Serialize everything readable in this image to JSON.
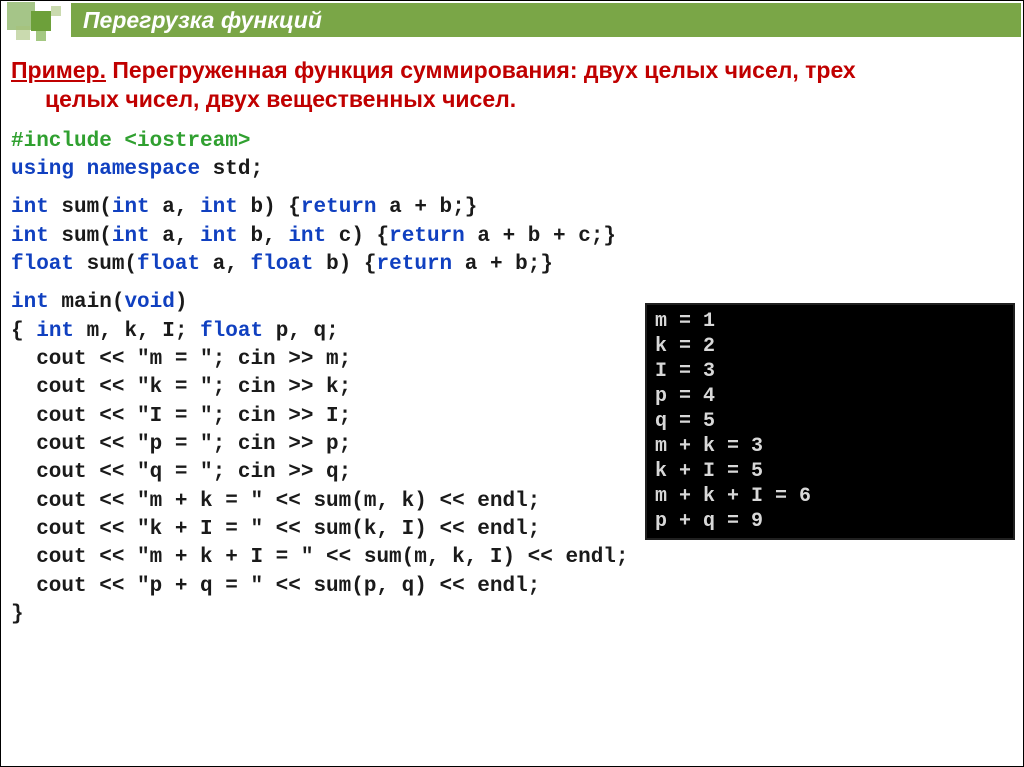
{
  "title": "Перегрузка функций",
  "intro": {
    "label": "Пример.",
    "line1_rest": " Перегруженная функция суммирования: двух целых чисел, трех",
    "line2": "целых чисел, двух вещественных чисел."
  },
  "code_block_a": {
    "include_directive": "#include",
    "include_header": " <iostream>",
    "using_kw": "using ",
    "namespace_kw": "namespace ",
    "std_txt": "std;"
  },
  "code_block_b": {
    "l1_t1": "int ",
    "l1_t2": "sum(",
    "l1_t3": "int ",
    "l1_t4": "a, ",
    "l1_t5": "int ",
    "l1_t6": "b) {",
    "l1_t7": "return ",
    "l1_t8": "a + b;}",
    "l2_t1": "int ",
    "l2_t2": "sum(",
    "l2_t3": "int ",
    "l2_t4": "a, ",
    "l2_t5": "int ",
    "l2_t6": "b, ",
    "l2_t7": "int ",
    "l2_t8": "c) {",
    "l2_t9": "return ",
    "l2_t10": "a + b + c;}",
    "l3_t1": "float ",
    "l3_t2": "sum(",
    "l3_t3": "float ",
    "l3_t4": "a, ",
    "l3_t5": "float ",
    "l3_t6": "b) {",
    "l3_t7": "return ",
    "l3_t8": "a + b;}"
  },
  "main_block": {
    "l1_t1": "int ",
    "l1_t2": "main(",
    "l1_t3": "void",
    "l1_t4": ")",
    "l2_t1": "{ ",
    "l2_t2": "int ",
    "l2_t3": "m, k, I;  ",
    "l2_t4": "float ",
    "l2_t5": "p, q;",
    "l3": "  cout << \"m = \"; cin >> m;",
    "l4": "  cout << \"k = \"; cin >> k;",
    "l5": "  cout << \"I = \"; cin >> I;",
    "l6": "  cout << \"p = \"; cin >> p;",
    "l7": "  cout << \"q = \"; cin >> q;",
    "l8": "  cout << \"m + k = \" << sum(m, k) << endl;",
    "l9": "  cout << \"k + I = \" << sum(k, I) << endl;",
    "l10": "  cout << \"m + k + I = \" << sum(m, k, I) << endl;",
    "l11": "  cout << \"p + q = \" << sum(p, q) << endl;",
    "l12": "}"
  },
  "output": {
    "l1": "m = 1",
    "l2": "k = 2",
    "l3": "I = 3",
    "l4": "p = 4",
    "l5": "q = 5",
    "l6": "m + k = 3",
    "l7": "k + I = 5",
    "l8": "m + k + I = 6",
    "l9": "p + q = 9"
  }
}
